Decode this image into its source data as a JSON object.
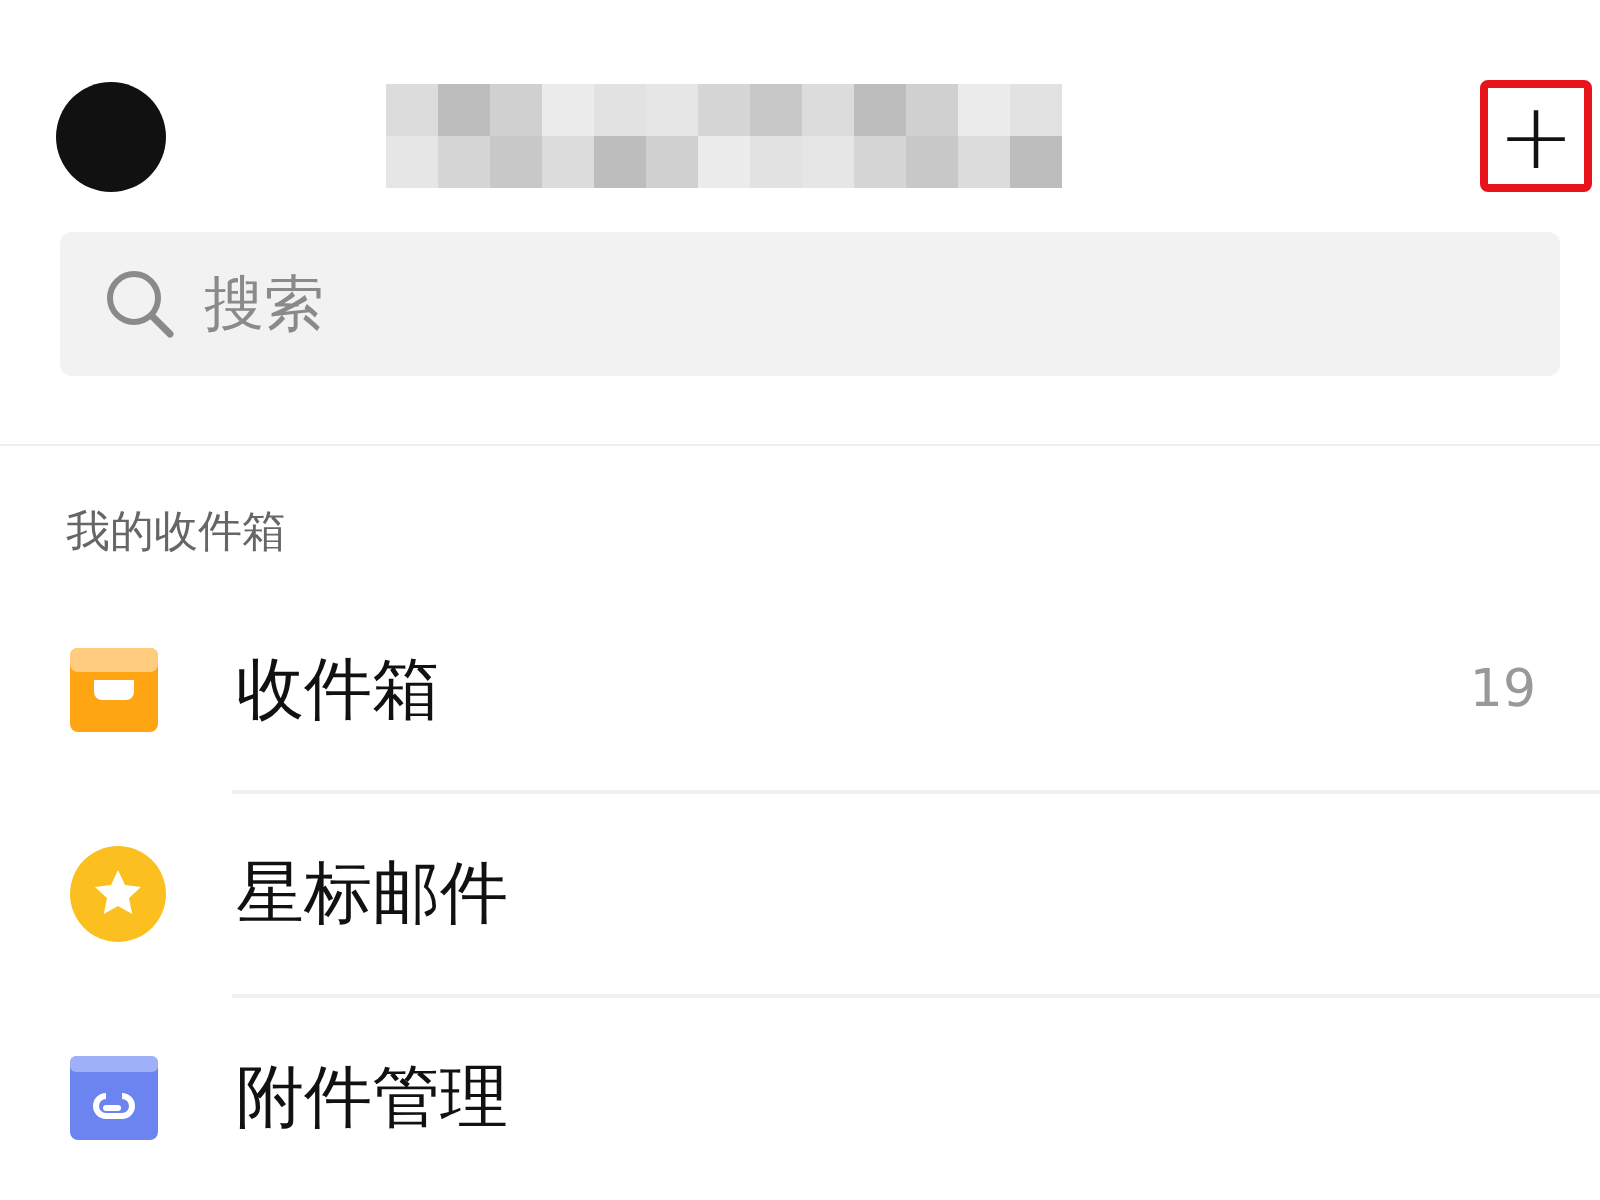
{
  "header": {
    "compose_button": {
      "label": "+",
      "highlighted": true
    }
  },
  "search": {
    "placeholder": "搜索"
  },
  "section": {
    "title": "我的收件箱"
  },
  "folders": [
    {
      "kind": "inbox",
      "name": "收件箱",
      "count": "19"
    },
    {
      "kind": "starred",
      "name": "星标邮件"
    },
    {
      "kind": "attachments",
      "name": "附件管理"
    }
  ]
}
